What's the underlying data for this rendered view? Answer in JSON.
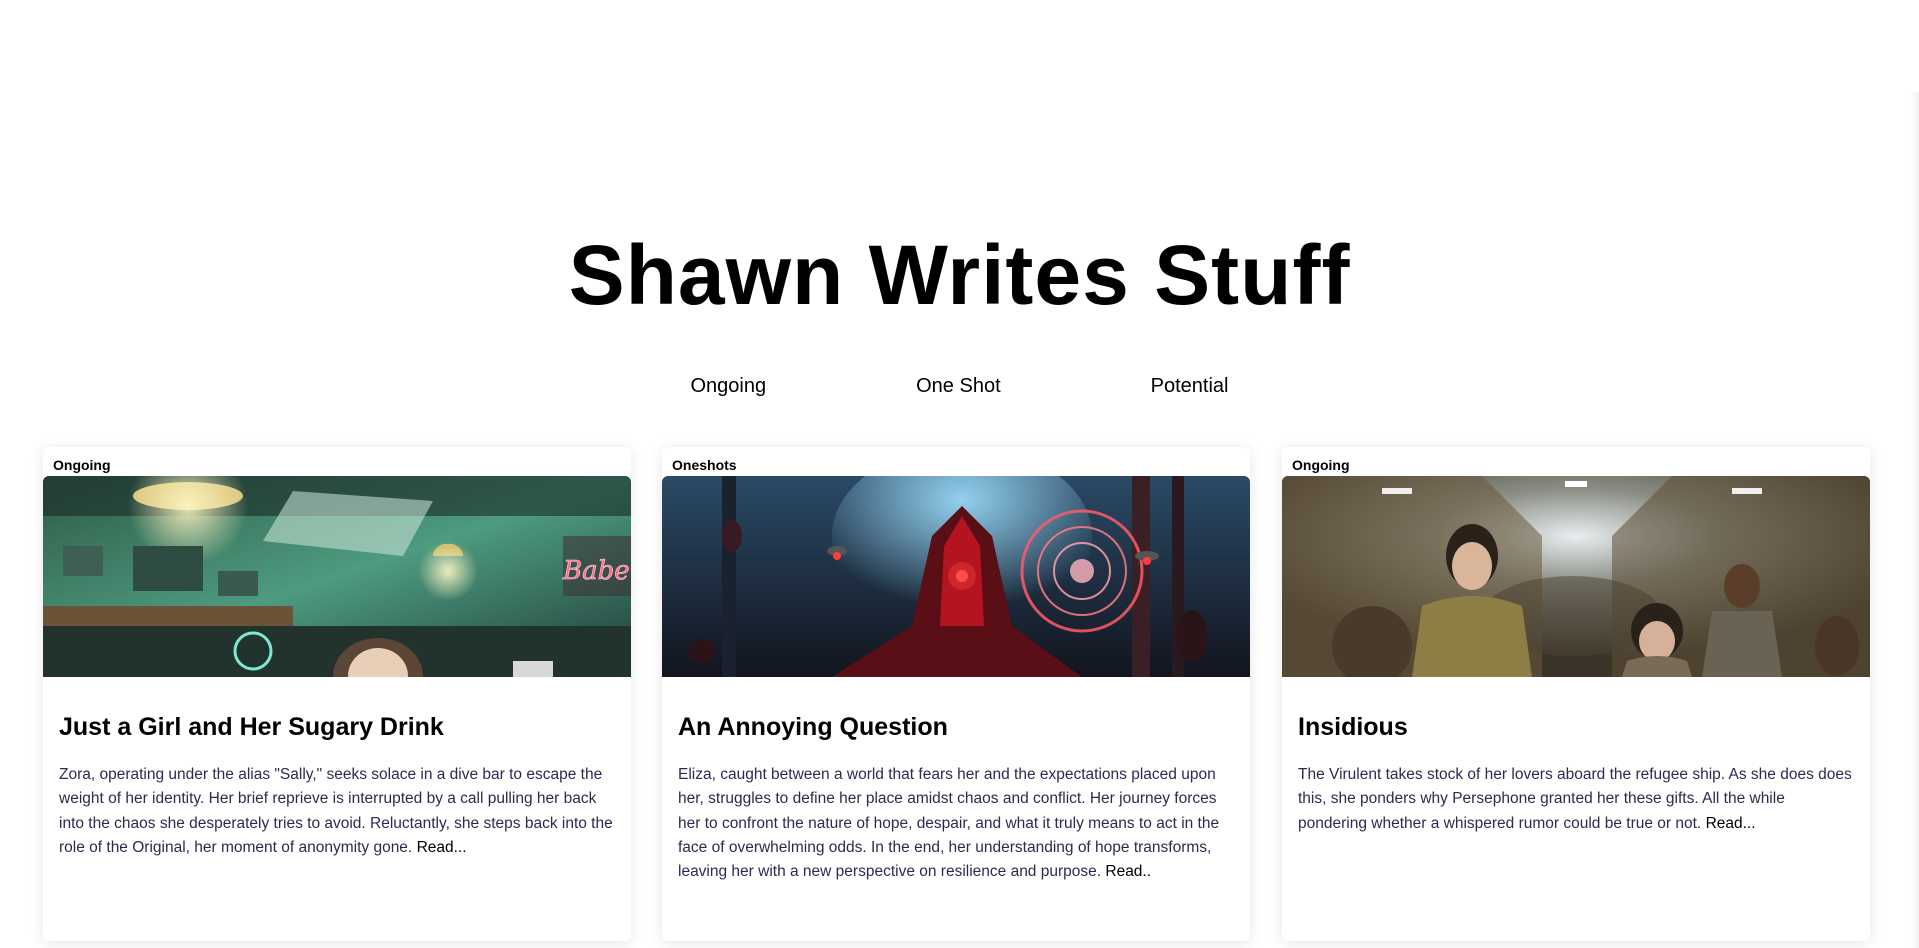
{
  "site": {
    "title": "Shawn Writes Stuff"
  },
  "nav": {
    "items": [
      "Ongoing",
      "One Shot",
      "Potential"
    ]
  },
  "cards": [
    {
      "tag": "Ongoing",
      "title": "Just a Girl and Her Sugary Drink",
      "summary": "Zora, operating under the alias \"Sally,\" seeks solace in a dive bar to escape the weight of her identity. Her brief reprieve is interrupted by a call pulling her back into the chaos she desperately tries to avoid. Reluctantly, she steps back into the role of the Original, her moment of anonymity gone.",
      "read_label": "Read...",
      "neon_sign": "Babe"
    },
    {
      "tag": "Oneshots",
      "title": "An Annoying Question",
      "summary": "Eliza, caught between a world that fears her and the expectations placed upon her, struggles to define her place amidst chaos and conflict. Her journey forces her to confront the nature of hope, despair, and what it truly means to act in the face of overwhelming odds. In the end, her understanding of hope transforms, leaving her with a new perspective on resilience and purpose.",
      "read_label": "Read.."
    },
    {
      "tag": "Ongoing",
      "title": "Insidious",
      "summary": "The Virulent takes stock of her lovers aboard the refugee ship. As she does does this, she ponders why Persephone granted her these gifts. All the while pondering whether a whispered rumor could be true or not.",
      "read_label": "Read..."
    }
  ],
  "colors": {
    "summary_text": "#2b2b4e",
    "card_shadow": "rgba(0,0,0,0.10)"
  }
}
